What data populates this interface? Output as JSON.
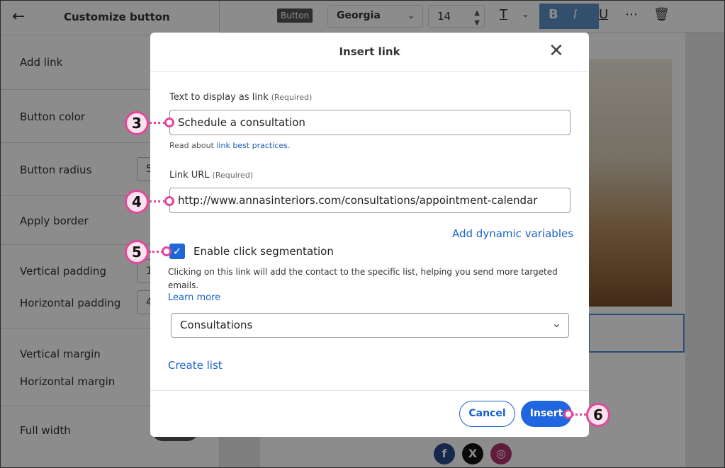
{
  "left_panel": {
    "title": "Customize button",
    "rows": [
      {
        "label": "Add link"
      },
      {
        "label": "Button color"
      },
      {
        "label": "Button radius",
        "value": "5"
      },
      {
        "label": "Apply border"
      },
      {
        "label": "Vertical padding",
        "value": "1"
      },
      {
        "label": "Horizontal padding",
        "value": "4"
      },
      {
        "label": "Vertical margin"
      },
      {
        "label": "Horizontal margin"
      },
      {
        "label": "Full width"
      }
    ]
  },
  "toolbar": {
    "chip": "Button",
    "font": "Georgia",
    "size": "14"
  },
  "modal": {
    "title": "Insert link",
    "display_text_label": "Text to display as link",
    "required": "(Required)",
    "display_text_value": "Schedule a consultation",
    "hint_prefix": "Read about ",
    "hint_link": "link best practices.",
    "url_label": "Link URL",
    "url_value": "http://www.annasinteriors.com/consultations/appointment-calendar",
    "dynamic_vars": "Add dynamic variables",
    "segmentation_label": "Enable click segmentation",
    "segmentation_desc": "Clicking on this link will add the contact to the specific list, helping you send more targeted emails.",
    "learn_more": "Learn more",
    "list_selected": "Consultations",
    "create_list": "Create list",
    "cancel": "Cancel",
    "insert": "Insert"
  },
  "callouts": {
    "c3": "3",
    "c4": "4",
    "c5": "5",
    "c6": "6"
  },
  "social": {
    "facebook": "f",
    "x": "X",
    "instagram": "◎"
  }
}
